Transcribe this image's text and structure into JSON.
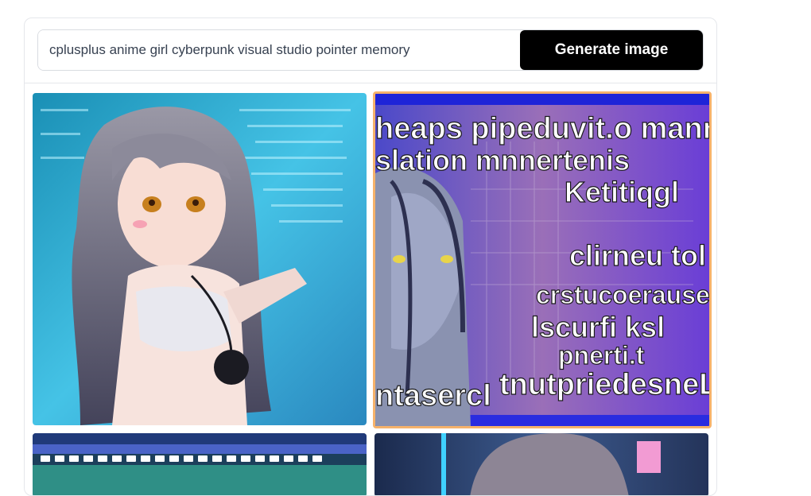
{
  "prompt": {
    "value": "cplusplus anime girl cyberpunk visual studio pointer memory",
    "button_label": "Generate image"
  },
  "gallery": {
    "selected_index": 1,
    "images": [
      {
        "icon": "anime-girl-cyan-image"
      },
      {
        "icon": "anime-girl-glitch-text-image"
      },
      {
        "icon": "code-editor-image"
      },
      {
        "icon": "anime-girl-neon-image"
      }
    ],
    "glitch_text": [
      "heaps pipeduvit.o manne",
      "slation mnnertenis",
      "Ketitiqgl",
      "clirneu tol",
      "crstucoerause",
      "lscurfi ksl",
      "pnerti.t",
      "tnutpriedesneL",
      "ntasercl"
    ]
  },
  "colors": {
    "selected_border": "#f6b26b",
    "button_bg": "#000000"
  }
}
